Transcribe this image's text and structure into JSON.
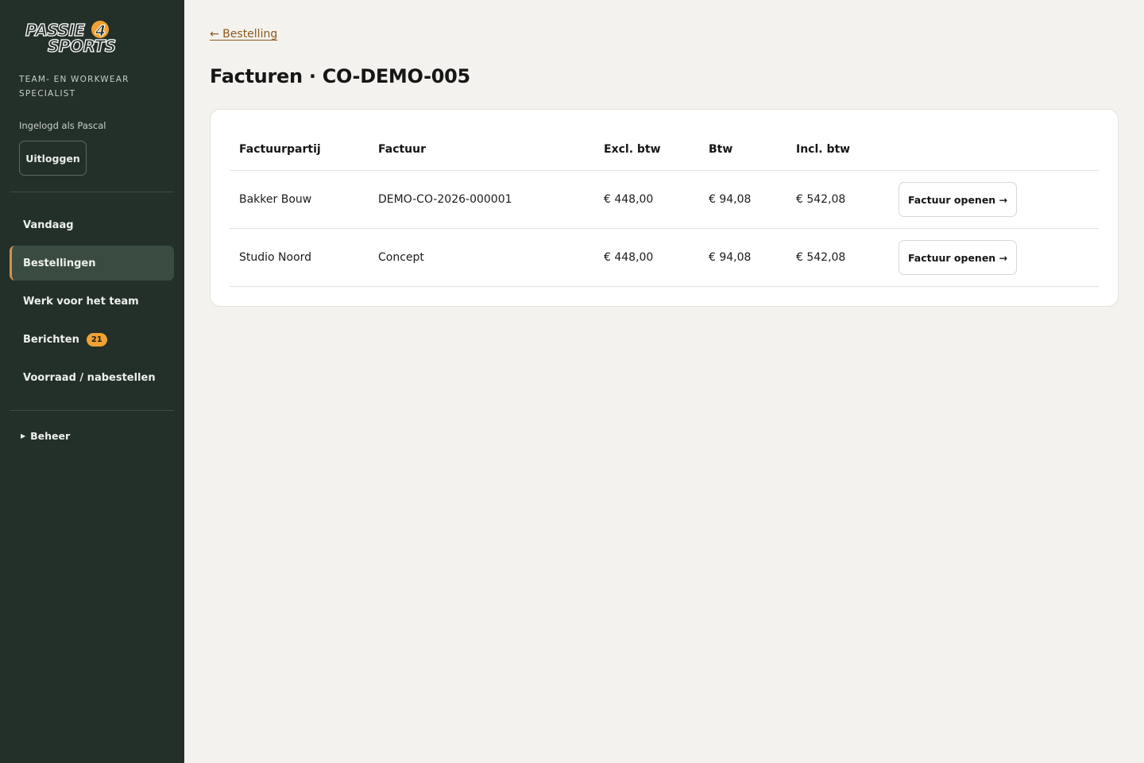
{
  "brand": {
    "logo_line1": "PASSIE",
    "logo_number": "4",
    "logo_line2": "SPORTS",
    "tagline": "TEAM- EN WORKWEAR SPECIALIST"
  },
  "user": {
    "logged_in_text": "Ingelogd als Pascal",
    "logout_label": "Uitloggen"
  },
  "nav": {
    "items": [
      {
        "label": "Vandaag"
      },
      {
        "label": "Bestellingen",
        "active": true
      },
      {
        "label": "Werk voor het team"
      },
      {
        "label": "Berichten",
        "badge": "21"
      },
      {
        "label": "Voorraad / nabestellen"
      }
    ],
    "beheer_label": "Beheer"
  },
  "main": {
    "back_label": "← Bestelling",
    "title": "Facturen · CO-DEMO-005",
    "table": {
      "headers": [
        "Factuurpartij",
        "Factuur",
        "Excl. btw",
        "Btw",
        "Incl. btw"
      ],
      "rows": [
        {
          "party": "Bakker Bouw",
          "invoice": "DEMO-CO-2026-000001",
          "excl": "€ 448,00",
          "btw": "€ 94,08",
          "incl": "€ 542,08",
          "action": "Factuur openen →"
        },
        {
          "party": "Studio Noord",
          "invoice": "Concept",
          "excl": "€ 448,00",
          "btw": "€ 94,08",
          "incl": "€ 542,08",
          "action": "Factuur openen →"
        }
      ]
    }
  },
  "colors": {
    "sidebar_bg": "#232f29",
    "active_accent": "#d39248",
    "badge_bg": "#f0a133",
    "page_bg": "#f3f2ee",
    "link": "#8a5a1e"
  }
}
